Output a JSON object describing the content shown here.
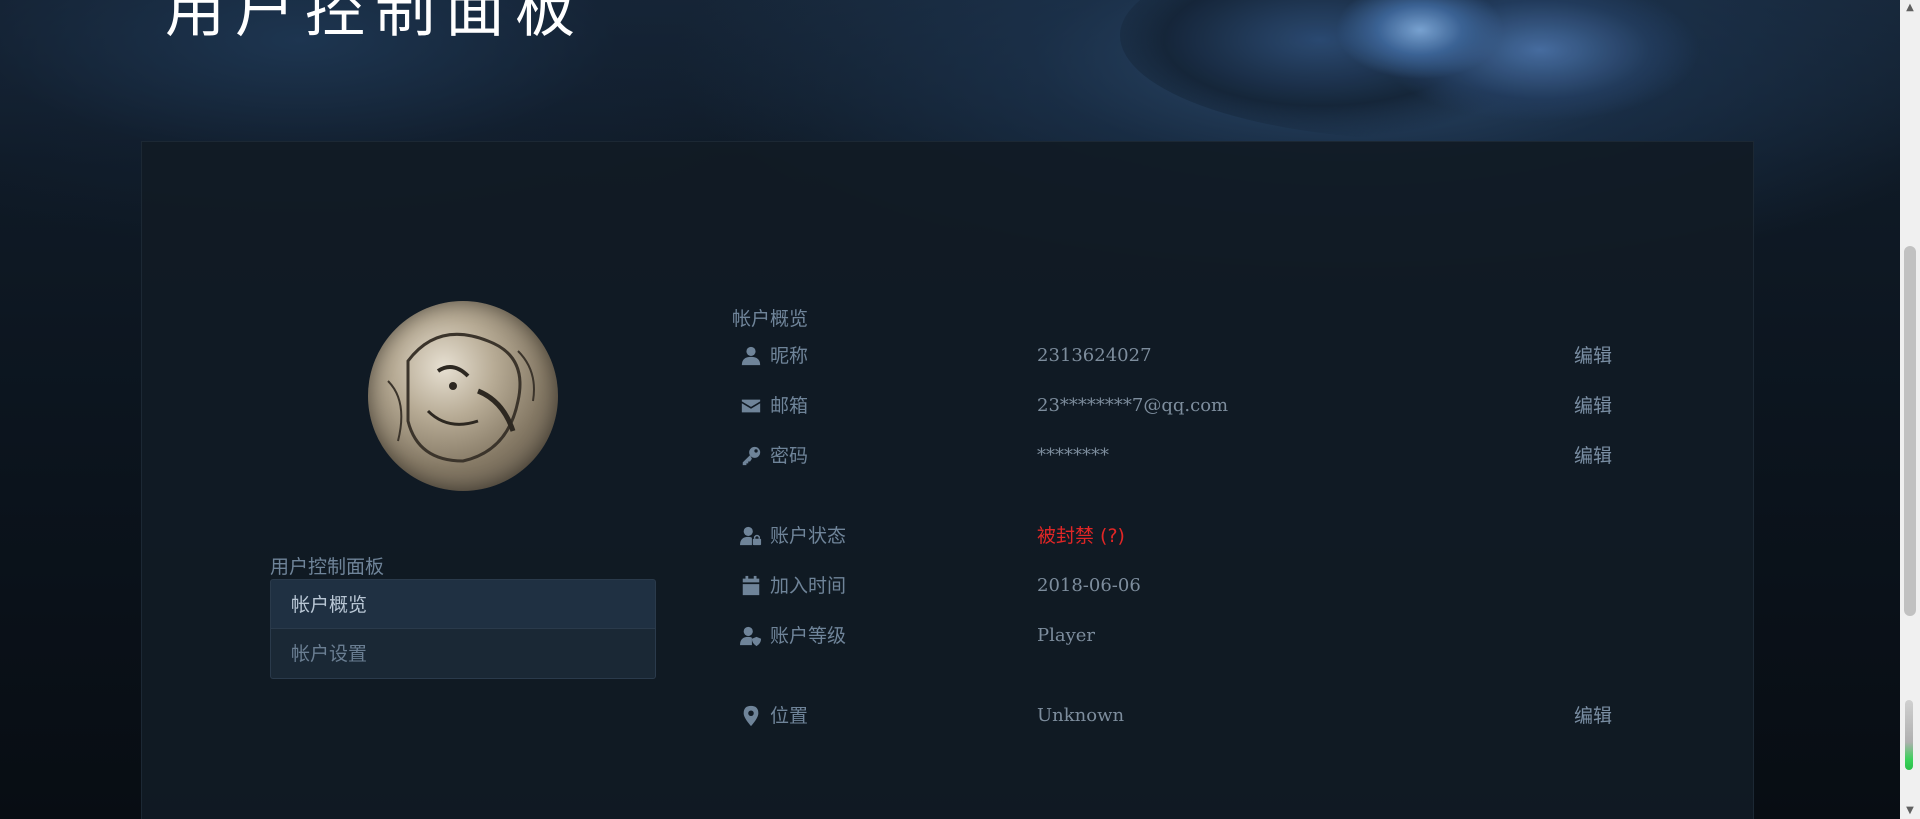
{
  "hero": {
    "title": "用户控制面板"
  },
  "sidebar": {
    "title": "用户控制面板",
    "items": [
      {
        "label": "帐户概览",
        "active": true
      },
      {
        "label": "帐户设置",
        "active": false
      }
    ]
  },
  "overview": {
    "title": "帐户概览",
    "rows": [
      {
        "icon": "user-icon",
        "label": "昵称",
        "value": "2313624027",
        "edit": "编辑"
      },
      {
        "icon": "envelope-icon",
        "label": "邮箱",
        "value": "23********7@qq.com",
        "edit": "编辑"
      },
      {
        "icon": "key-icon",
        "label": "密码",
        "value": "********",
        "edit": "编辑"
      },
      {
        "icon": "user-lock-icon",
        "label": "账户状态",
        "value": "被封禁 (?)"
      },
      {
        "icon": "calendar-icon",
        "label": "加入时间",
        "value": "2018-06-06"
      },
      {
        "icon": "user-shield-icon",
        "label": "账户等级",
        "value": "Player"
      },
      {
        "icon": "map-marker-icon",
        "label": "位置",
        "value": "Unknown",
        "edit": "编辑"
      }
    ]
  },
  "colors": {
    "banned": "#e02626",
    "label": "#6f8499",
    "panel": "#111b25"
  }
}
